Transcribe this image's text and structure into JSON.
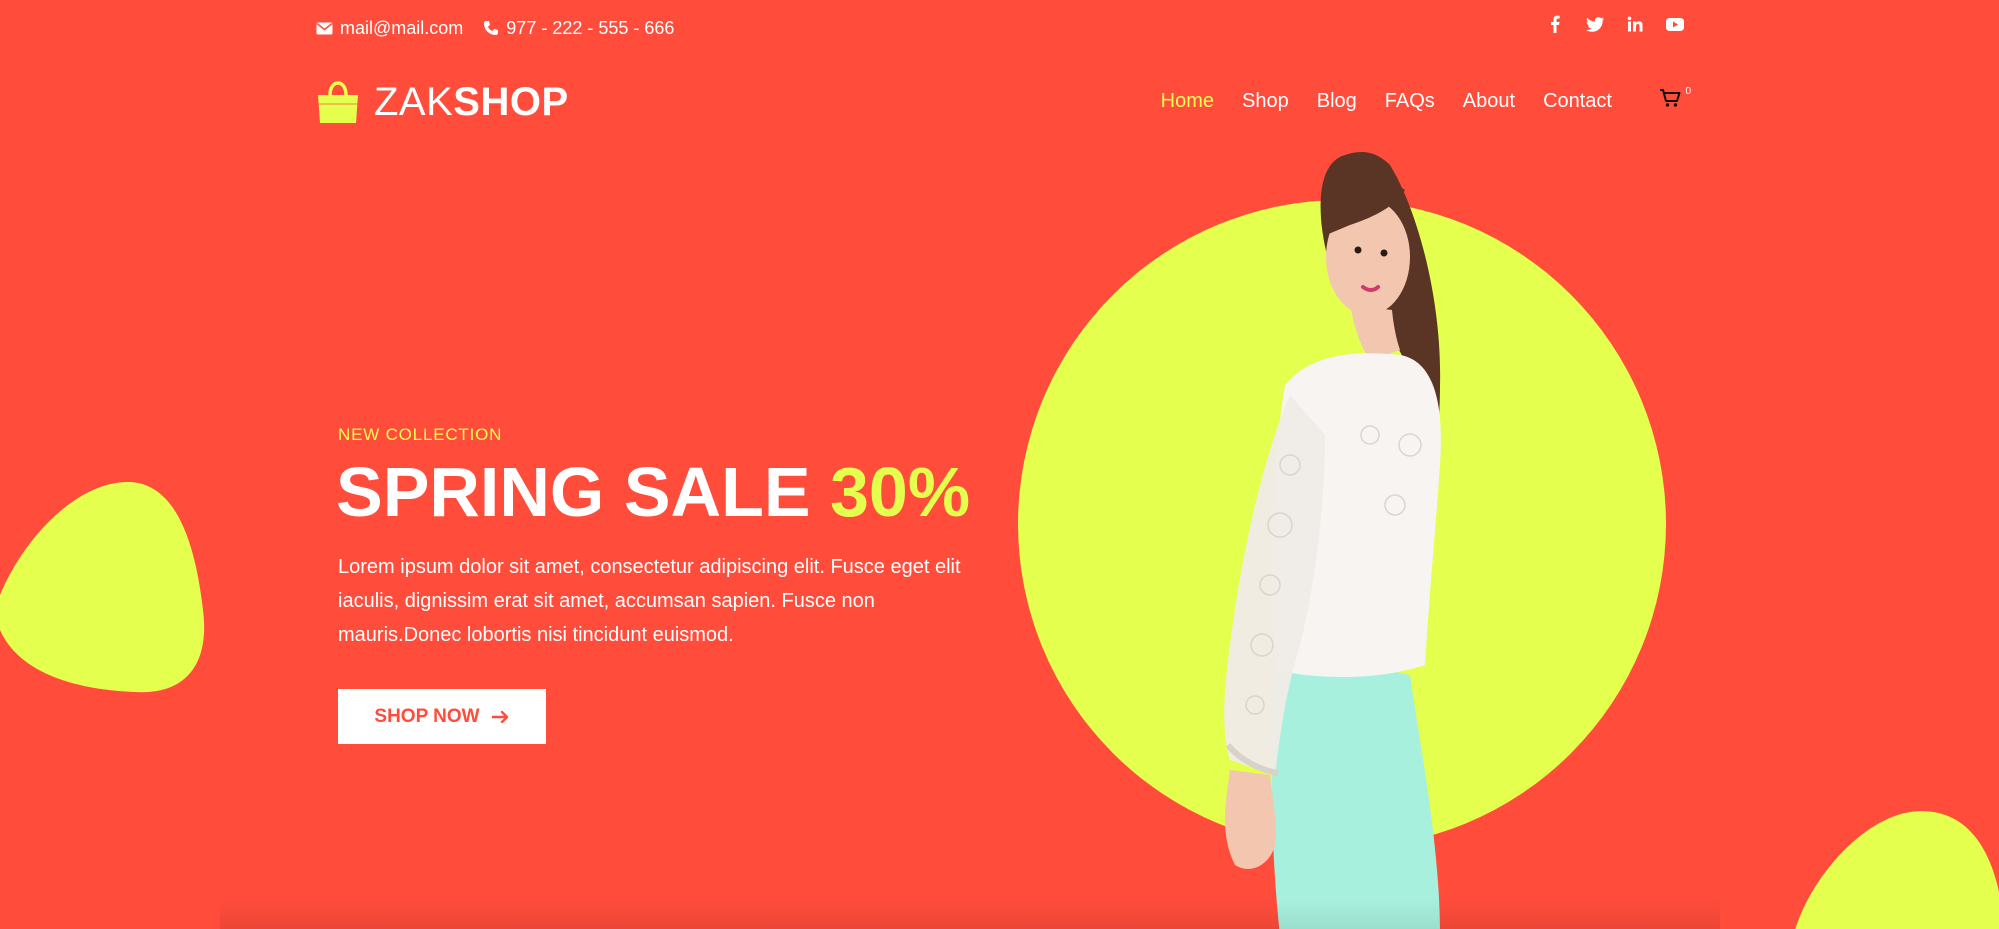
{
  "topbar": {
    "email": "mail@mail.com",
    "phone": "977 - 222 - 555 - 666",
    "email_icon": "envelope-icon",
    "phone_icon": "phone-icon",
    "social": [
      "facebook-icon",
      "twitter-icon",
      "linkedin-icon",
      "youtube-icon"
    ]
  },
  "logo": {
    "part1": "ZAK",
    "part2": "SHOP",
    "icon": "shopping-bag-icon"
  },
  "nav": {
    "items": [
      "Home",
      "Shop",
      "Blog",
      "FAQs",
      "About",
      "Contact"
    ],
    "active_index": 0
  },
  "cart": {
    "count": "0",
    "icon": "cart-icon"
  },
  "hero": {
    "eyebrow": "NEW COLLECTION",
    "headline": "SPRING SALE",
    "headline_accent": "30%",
    "description": "Lorem ipsum dolor sit amet, consectetur adipiscing elit. Fusce eget elit iaculis, dignissim erat sit amet, accumsan sapien. Fusce non mauris.Donec lobortis nisi tincidunt euismod.",
    "cta_label": "SHOP NOW",
    "cta_icon": "arrow-right-icon"
  },
  "colors": {
    "background": "#ff4c3b",
    "accent": "#e4ff4e",
    "active_nav": "#f4ff56",
    "text": "#ffffff"
  }
}
